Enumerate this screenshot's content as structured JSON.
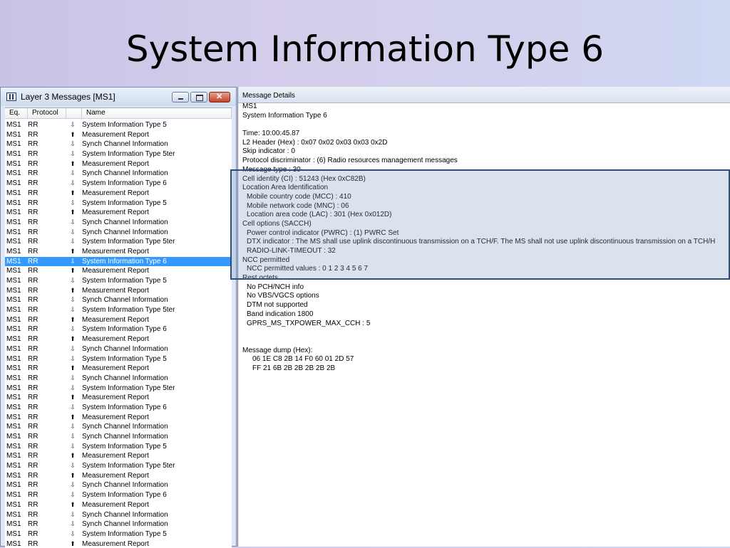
{
  "slide": {
    "title": "System Information Type 6"
  },
  "left_window": {
    "title": "Layer 3 Messages  [MS1]",
    "columns": {
      "eq": "Eq.",
      "protocol": "Protocol",
      "name": "Name"
    },
    "rows": [
      {
        "eq": "MS1",
        "protocol": "RR",
        "dir": "down",
        "name": "System Information Type 5"
      },
      {
        "eq": "MS1",
        "protocol": "RR",
        "dir": "up",
        "name": "Measurement Report"
      },
      {
        "eq": "MS1",
        "protocol": "RR",
        "dir": "down",
        "name": "Synch Channel Information"
      },
      {
        "eq": "MS1",
        "protocol": "RR",
        "dir": "down",
        "name": "System Information Type 5ter"
      },
      {
        "eq": "MS1",
        "protocol": "RR",
        "dir": "up",
        "name": "Measurement Report"
      },
      {
        "eq": "MS1",
        "protocol": "RR",
        "dir": "down",
        "name": "Synch Channel Information"
      },
      {
        "eq": "MS1",
        "protocol": "RR",
        "dir": "down",
        "name": "System Information Type 6"
      },
      {
        "eq": "MS1",
        "protocol": "RR",
        "dir": "up",
        "name": "Measurement Report"
      },
      {
        "eq": "MS1",
        "protocol": "RR",
        "dir": "down",
        "name": "System Information Type 5"
      },
      {
        "eq": "MS1",
        "protocol": "RR",
        "dir": "up",
        "name": "Measurement Report"
      },
      {
        "eq": "MS1",
        "protocol": "RR",
        "dir": "down",
        "name": "Synch Channel Information"
      },
      {
        "eq": "MS1",
        "protocol": "RR",
        "dir": "down",
        "name": "Synch Channel Information"
      },
      {
        "eq": "MS1",
        "protocol": "RR",
        "dir": "down",
        "name": "System Information Type 5ter"
      },
      {
        "eq": "MS1",
        "protocol": "RR",
        "dir": "up",
        "name": "Measurement Report"
      },
      {
        "eq": "MS1",
        "protocol": "RR",
        "dir": "down",
        "name": "System Information Type 6",
        "selected": true
      },
      {
        "eq": "MS1",
        "protocol": "RR",
        "dir": "up",
        "name": "Measurement Report"
      },
      {
        "eq": "MS1",
        "protocol": "RR",
        "dir": "down",
        "name": "System Information Type 5"
      },
      {
        "eq": "MS1",
        "protocol": "RR",
        "dir": "up",
        "name": "Measurement Report"
      },
      {
        "eq": "MS1",
        "protocol": "RR",
        "dir": "down",
        "name": "Synch Channel Information"
      },
      {
        "eq": "MS1",
        "protocol": "RR",
        "dir": "down",
        "name": "System Information Type 5ter"
      },
      {
        "eq": "MS1",
        "protocol": "RR",
        "dir": "up",
        "name": "Measurement Report"
      },
      {
        "eq": "MS1",
        "protocol": "RR",
        "dir": "down",
        "name": "System Information Type 6"
      },
      {
        "eq": "MS1",
        "protocol": "RR",
        "dir": "up",
        "name": "Measurement Report"
      },
      {
        "eq": "MS1",
        "protocol": "RR",
        "dir": "down",
        "name": "Synch Channel Information"
      },
      {
        "eq": "MS1",
        "protocol": "RR",
        "dir": "down",
        "name": "System Information Type 5"
      },
      {
        "eq": "MS1",
        "protocol": "RR",
        "dir": "up",
        "name": "Measurement Report"
      },
      {
        "eq": "MS1",
        "protocol": "RR",
        "dir": "down",
        "name": "Synch Channel Information"
      },
      {
        "eq": "MS1",
        "protocol": "RR",
        "dir": "down",
        "name": "System Information Type 5ter"
      },
      {
        "eq": "MS1",
        "protocol": "RR",
        "dir": "up",
        "name": "Measurement Report"
      },
      {
        "eq": "MS1",
        "protocol": "RR",
        "dir": "down",
        "name": "System Information Type 6"
      },
      {
        "eq": "MS1",
        "protocol": "RR",
        "dir": "up",
        "name": "Measurement Report"
      },
      {
        "eq": "MS1",
        "protocol": "RR",
        "dir": "down",
        "name": "Synch Channel Information"
      },
      {
        "eq": "MS1",
        "protocol": "RR",
        "dir": "down",
        "name": "Synch Channel Information"
      },
      {
        "eq": "MS1",
        "protocol": "RR",
        "dir": "down",
        "name": "System Information Type 5"
      },
      {
        "eq": "MS1",
        "protocol": "RR",
        "dir": "up",
        "name": "Measurement Report"
      },
      {
        "eq": "MS1",
        "protocol": "RR",
        "dir": "down",
        "name": "System Information Type 5ter"
      },
      {
        "eq": "MS1",
        "protocol": "RR",
        "dir": "up",
        "name": "Measurement Report"
      },
      {
        "eq": "MS1",
        "protocol": "RR",
        "dir": "down",
        "name": "Synch Channel Information"
      },
      {
        "eq": "MS1",
        "protocol": "RR",
        "dir": "down",
        "name": "System Information Type 6"
      },
      {
        "eq": "MS1",
        "protocol": "RR",
        "dir": "up",
        "name": "Measurement Report"
      },
      {
        "eq": "MS1",
        "protocol": "RR",
        "dir": "down",
        "name": "Synch Channel Information"
      },
      {
        "eq": "MS1",
        "protocol": "RR",
        "dir": "down",
        "name": "Synch Channel Information"
      },
      {
        "eq": "MS1",
        "protocol": "RR",
        "dir": "down",
        "name": "System Information Type 5"
      },
      {
        "eq": "MS1",
        "protocol": "RR",
        "dir": "up",
        "name": "Measurement Report"
      }
    ]
  },
  "right_window": {
    "title": "Message Details",
    "lines": [
      {
        "text": "MS1",
        "indent": 0
      },
      {
        "text": "System Information Type 6",
        "indent": 0
      },
      {
        "text": "",
        "indent": 0
      },
      {
        "text": "Time: 10:00:45.87",
        "indent": 0
      },
      {
        "text": "L2 Header (Hex) : 0x07 0x02 0x03 0x03 0x2D",
        "indent": 0
      },
      {
        "text": "Skip indicator : 0",
        "indent": 0
      },
      {
        "text": "Protocol discriminator : (6) Radio resources management messages",
        "indent": 0
      },
      {
        "text": "Message type : 30",
        "indent": 0
      },
      {
        "text": "Cell identity (CI) : 51243 (Hex 0xC82B)",
        "indent": 0
      },
      {
        "text": "Location Area Identification",
        "indent": 0
      },
      {
        "text": "Mobile country code (MCC) : 410",
        "indent": 1
      },
      {
        "text": "Mobile network code (MNC) : 06",
        "indent": 1
      },
      {
        "text": "Location area code (LAC) : 301 (Hex 0x012D)",
        "indent": 1
      },
      {
        "text": "Cell options (SACCH)",
        "indent": 0
      },
      {
        "text": "Power control indicator (PWRC) : (1) PWRC Set",
        "indent": 1
      },
      {
        "text": "DTX indicator : The MS shall use uplink discontinuous transmission on a TCH/F. The MS shall not use uplink discontinuous transmission on a TCH/H",
        "indent": 1
      },
      {
        "text": "RADIO-LINK-TIMEOUT : 32",
        "indent": 1
      },
      {
        "text": "NCC permitted",
        "indent": 0
      },
      {
        "text": "NCC permitted values : 0 1 2 3 4 5 6 7",
        "indent": 1
      },
      {
        "text": "Rest octets",
        "indent": 0
      },
      {
        "text": "No PCH/NCH info",
        "indent": 1
      },
      {
        "text": "No VBS/VGCS options",
        "indent": 1
      },
      {
        "text": "DTM not supported",
        "indent": 1
      },
      {
        "text": "Band indication 1800",
        "indent": 1
      },
      {
        "text": "GPRS_MS_TXPOWER_MAX_CCH : 5",
        "indent": 1
      },
      {
        "text": "",
        "indent": 0
      },
      {
        "text": "",
        "indent": 0
      },
      {
        "text": "Message dump (Hex):",
        "indent": 0
      },
      {
        "text": "06 1E C8 2B 14 F0 60 01 2D 57",
        "indent": 2
      },
      {
        "text": "FF 21 6B 2B 2B 2B 2B 2B",
        "indent": 2
      }
    ]
  }
}
